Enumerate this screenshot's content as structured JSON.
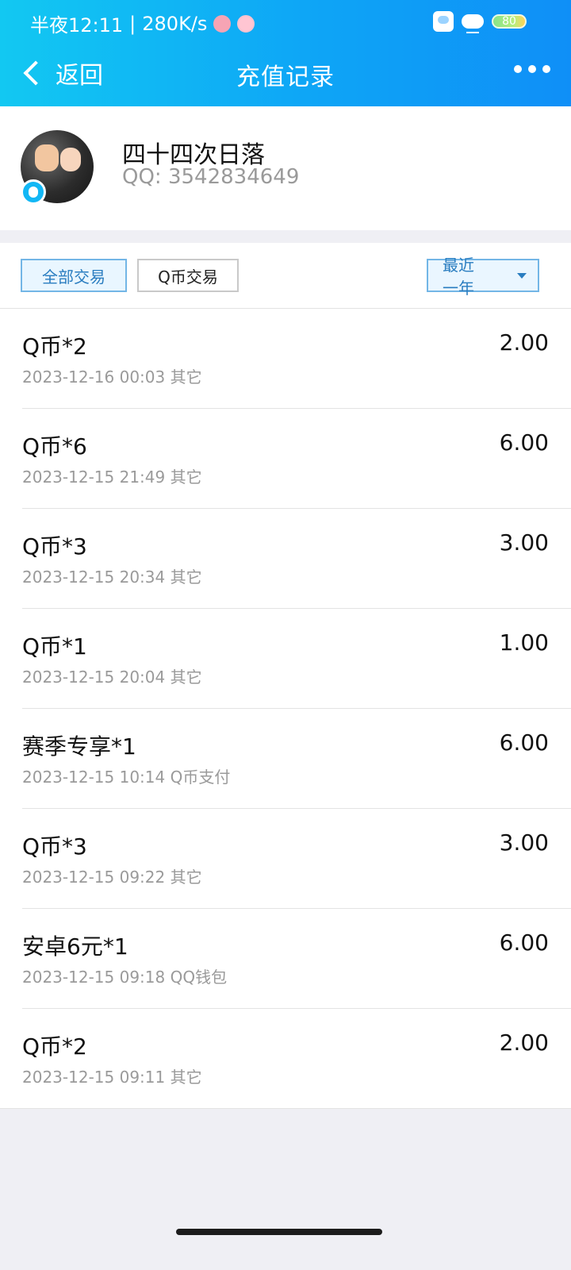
{
  "status_bar": {
    "time": "半夜12:11",
    "separator": "|",
    "network_speed": "280K/s",
    "battery_level": "80"
  },
  "nav": {
    "back_label": "返回",
    "title": "充值记录"
  },
  "profile": {
    "nickname": "四十四次日落",
    "qq_text": "QQ: 3542834649"
  },
  "filters": {
    "all_label": "全部交易",
    "qcoin_label": "Q币交易",
    "range_label": "最近一年"
  },
  "transactions": [
    {
      "name": "Q币*2",
      "amount": "2.00",
      "datetime": "2023-12-16 00:03",
      "channel": "其它"
    },
    {
      "name": "Q币*6",
      "amount": "6.00",
      "datetime": "2023-12-15 21:49",
      "channel": "其它"
    },
    {
      "name": "Q币*3",
      "amount": "3.00",
      "datetime": "2023-12-15 20:34",
      "channel": "其它"
    },
    {
      "name": "Q币*1",
      "amount": "1.00",
      "datetime": "2023-12-15 20:04",
      "channel": "其它"
    },
    {
      "name": "赛季专享*1",
      "amount": "6.00",
      "datetime": "2023-12-15 10:14",
      "channel": "Q币支付"
    },
    {
      "name": "Q币*3",
      "amount": "3.00",
      "datetime": "2023-12-15 09:22",
      "channel": "其它"
    },
    {
      "name": "安卓6元*1",
      "amount": "6.00",
      "datetime": "2023-12-15 09:18",
      "channel": "QQ钱包"
    },
    {
      "name": "Q币*2",
      "amount": "2.00",
      "datetime": "2023-12-15 09:11",
      "channel": "其它"
    }
  ]
}
